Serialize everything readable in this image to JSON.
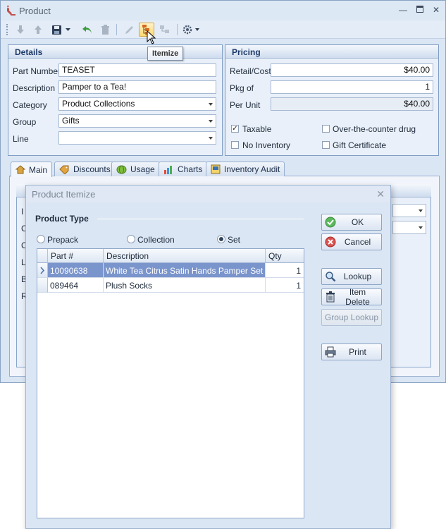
{
  "window": {
    "title": "Product",
    "icon": "product-app-icon",
    "controls": [
      "minimize-icon",
      "maximize-icon",
      "close-icon"
    ]
  },
  "toolbar": {
    "buttons": [
      "arrow-down-icon",
      "arrow-up-icon",
      "save-icon",
      "dropdown-icon",
      "undo-icon",
      "delete-icon",
      "edit-pencil-icon",
      "itemize-icon",
      "group-icon",
      "settings-icon"
    ],
    "tooltip": "Itemize"
  },
  "details": {
    "title": "Details",
    "labels": {
      "part_number": "Part Number",
      "description": "Description",
      "category": "Category",
      "group": "Group",
      "line": "Line"
    },
    "values": {
      "part_number": "TEASET",
      "description": "Pamper to a Tea!",
      "category": "Product Collections",
      "group": "Gifts",
      "line": ""
    }
  },
  "pricing": {
    "title": "Pricing",
    "labels": {
      "retail": "Retail/Cost",
      "pkg": "Pkg of",
      "per_unit": "Per Unit"
    },
    "values": {
      "retail": "$40.00",
      "pkg": "1",
      "per_unit": "$40.00"
    },
    "checks": {
      "taxable": {
        "label": "Taxable",
        "checked": true
      },
      "otc": {
        "label": "Over-the-counter drug",
        "checked": false
      },
      "no_inventory": {
        "label": "No Inventory",
        "checked": false
      },
      "gift_certificate": {
        "label": "Gift Certificate",
        "checked": false
      }
    }
  },
  "tabs": [
    {
      "label": "Main",
      "icon": "home-icon",
      "active": true
    },
    {
      "label": "Discounts",
      "icon": "tag-icon",
      "active": false
    },
    {
      "label": "Usage",
      "icon": "usage-icon",
      "active": false
    },
    {
      "label": "Charts",
      "icon": "bar-chart-icon",
      "active": false
    },
    {
      "label": "Inventory Audit",
      "icon": "audit-icon",
      "active": false
    }
  ],
  "background_form_letters": [
    "I",
    "C",
    "C",
    "L",
    "B",
    "R"
  ],
  "dialog": {
    "title": "Product Itemize",
    "group_title": "Product Type",
    "radios": [
      {
        "label": "Prepack",
        "selected": false
      },
      {
        "label": "Collection",
        "selected": false
      },
      {
        "label": "Set",
        "selected": true
      }
    ],
    "grid": {
      "columns": [
        "Part #",
        "Description",
        "Qty"
      ],
      "rows": [
        {
          "part": "10090638",
          "description": "White Tea Citrus Satin Hands Pamper Set",
          "qty": "1",
          "selected": true
        },
        {
          "part": "089464",
          "description": "Plush Socks",
          "qty": "1",
          "selected": false
        }
      ]
    },
    "buttons": {
      "ok": "OK",
      "cancel": "Cancel",
      "lookup": "Lookup",
      "item_delete": "Item Delete",
      "group_lookup": "Group Lookup",
      "print": "Print"
    }
  },
  "colors": {
    "selection": "#7a94cc",
    "panel_header_text": "#1e3a68",
    "window_bg": "#dbe6f4"
  }
}
